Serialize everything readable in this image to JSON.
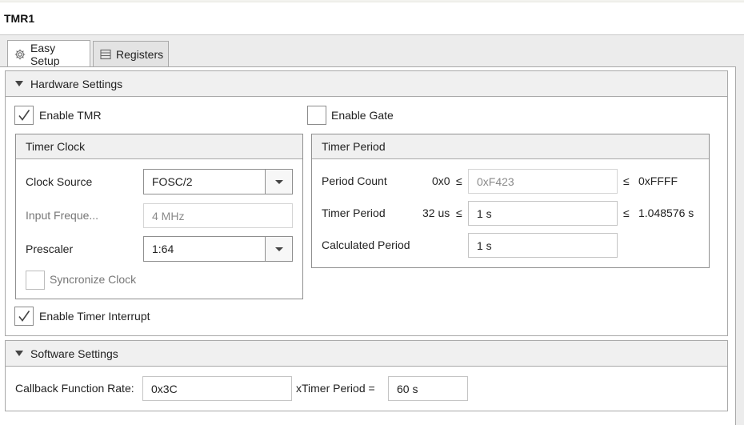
{
  "window": {
    "title": "TMR1"
  },
  "tabs": [
    {
      "label": "Easy Setup",
      "icon": "gear-icon",
      "active": true
    },
    {
      "label": "Registers",
      "icon": "list-icon",
      "active": false
    }
  ],
  "hardware": {
    "title": "Hardware Settings",
    "enable_tmr": {
      "label": "Enable TMR",
      "checked": true
    },
    "enable_gate": {
      "label": "Enable Gate",
      "checked": false
    },
    "timer_clock": {
      "title": "Timer Clock",
      "clock_source": {
        "label": "Clock Source",
        "value": "FOSC/2"
      },
      "input_frequency": {
        "label": "Input Freque...",
        "value": "4 MHz"
      },
      "prescaler": {
        "label": "Prescaler",
        "value": "1:64"
      },
      "sync_clock": {
        "label": "Syncronize Clock",
        "checked": false
      }
    },
    "timer_period": {
      "title": "Timer Period",
      "period_count": {
        "label": "Period Count",
        "min": "0x0",
        "le1": "≤",
        "value": "0xF423",
        "le2": "≤",
        "max": "0xFFFF"
      },
      "timer_period": {
        "label": "Timer Period",
        "min": "32 us",
        "le1": "≤",
        "value": "1 s",
        "le2": "≤",
        "max": "1.048576 s"
      },
      "calculated_period": {
        "label": "Calculated Period",
        "value": "1 s"
      }
    },
    "enable_interrupt": {
      "label": "Enable Timer Interrupt",
      "checked": true
    }
  },
  "software": {
    "title": "Software Settings",
    "callback_rate": {
      "label": "Callback Function Rate:",
      "value": "0x3C"
    },
    "xtimer_label": "xTimer Period =",
    "xtimer_value": "60 s"
  },
  "colors": {
    "border": "#a9a9a9",
    "header_bg": "#f0f0f0",
    "check": "#444444"
  }
}
